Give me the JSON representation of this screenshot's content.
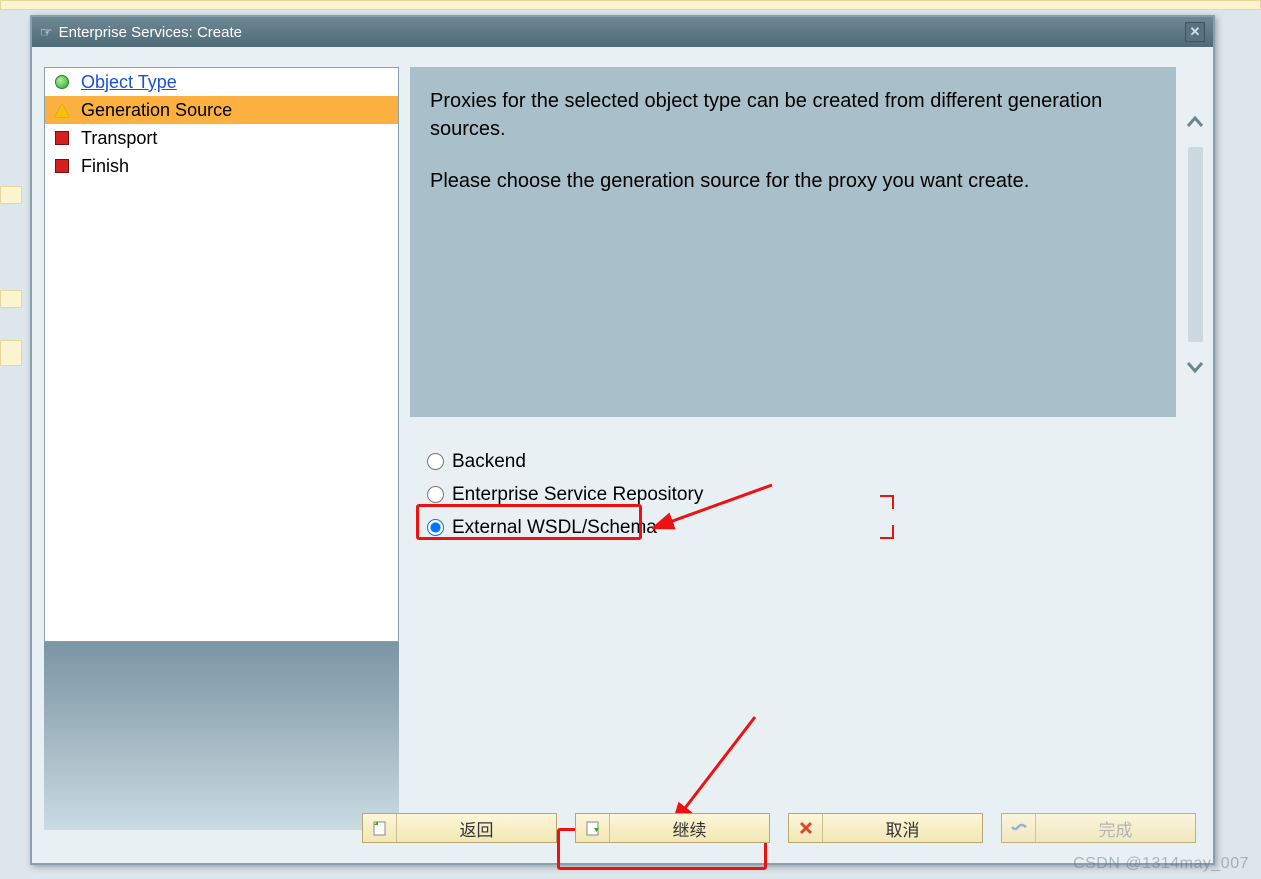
{
  "dialog": {
    "title": "Enterprise Services: Create"
  },
  "sidebar": {
    "items": [
      {
        "label": "Object Type",
        "status": "green",
        "link": true,
        "active": false
      },
      {
        "label": "Generation Source",
        "status": "yellow",
        "link": false,
        "active": true
      },
      {
        "label": "Transport",
        "status": "red",
        "link": false,
        "active": false
      },
      {
        "label": "Finish",
        "status": "red",
        "link": false,
        "active": false
      }
    ]
  },
  "content": {
    "paragraph1": "Proxies for the selected object type can be created from different generation sources.",
    "paragraph2": "Please choose the generation source for the proxy you want create."
  },
  "radios": {
    "options": [
      {
        "label": "Backend",
        "selected": false
      },
      {
        "label": "Enterprise Service Repository",
        "selected": false
      },
      {
        "label": "External WSDL/Schema",
        "selected": true
      }
    ]
  },
  "buttons": {
    "back": "返回",
    "continue": "继续",
    "cancel": "取消",
    "complete": "完成"
  },
  "watermark": "CSDN @1314may_007"
}
